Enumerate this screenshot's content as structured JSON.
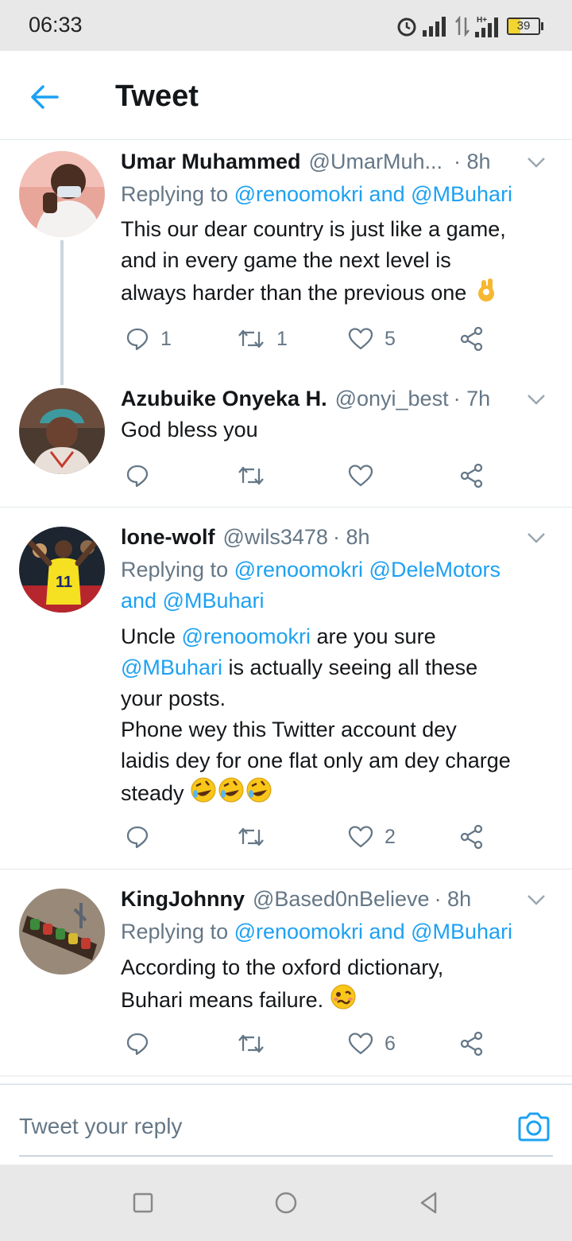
{
  "status_bar": {
    "time": "06:33",
    "battery": "39",
    "network": "H+"
  },
  "header": {
    "title": "Tweet"
  },
  "tweets": [
    {
      "name": "Umar Muhammed",
      "handle": "@UmarMuh...",
      "time": "· 8h",
      "reply_to": {
        "prefix": "Replying to ",
        "mentions": "@renoomokri and @MBuhari"
      },
      "lines": [
        "This our dear country is just like a game,",
        "and in every game the next level is",
        "always harder than the previous one"
      ],
      "emoji_end": "ok-hand",
      "counts": {
        "replies": "1",
        "retweets": "1",
        "likes": "5"
      }
    },
    {
      "name": "Azubuike Onyeka H.",
      "handle": "@onyi_best",
      "time": "· 7h",
      "lines": [
        "God bless you"
      ],
      "counts": {
        "replies": "",
        "retweets": "",
        "likes": ""
      }
    },
    {
      "name": "lone-wolf",
      "handle": "@wils3478",
      "time": "· 8h",
      "reply_to": {
        "prefix": "Replying to ",
        "mentions": "@renoomokri @DeleMotors",
        "line2": "and @MBuhari"
      },
      "body": {
        "l1_a": "Uncle ",
        "l1_mention": "@renoomokri",
        "l1_b": " are you sure",
        "l2_mention": "@MBuhari",
        "l2_b": " is actually seeing all these",
        "l3": "your posts.",
        "l4": "Phone wey this Twitter account dey",
        "l5": "laidis dey for one flat only am dey charge",
        "l6": "steady"
      },
      "emoji_end": "rolling-on-floor-laughing x3",
      "counts": {
        "replies": "",
        "retweets": "",
        "likes": "2"
      }
    },
    {
      "name": "KingJohnny",
      "handle": "@Based0nBelieve",
      "time": "· 8h",
      "reply_to": {
        "prefix": "Replying to ",
        "mentions": "@renoomokri and @MBuhari"
      },
      "lines": [
        "According to the oxford dictionary,",
        "Buhari means failure."
      ],
      "emoji_end": "woozy-face",
      "counts": {
        "replies": "",
        "retweets": "",
        "likes": "6"
      }
    }
  ],
  "reply_bar": {
    "placeholder": "Tweet your reply"
  },
  "colors": {
    "accent": "#1da1f2",
    "text": "#14171a",
    "muted": "#657786",
    "divider": "#e1e8ed",
    "system_bar": "#e8e8e8"
  },
  "icons": [
    "back-arrow-icon",
    "chevron-down-icon",
    "reply-icon",
    "retweet-icon",
    "like-icon",
    "share-icon",
    "camera-icon",
    "recents-icon",
    "home-icon",
    "nav-back-icon"
  ]
}
